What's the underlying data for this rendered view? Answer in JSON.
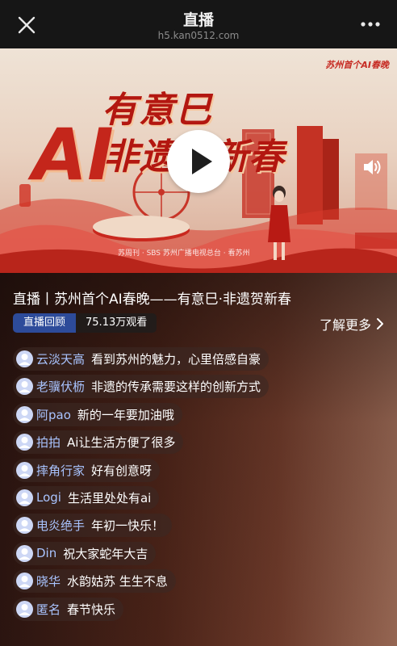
{
  "header": {
    "title": "直播",
    "url": "h5.kan0512.com"
  },
  "video": {
    "brand_tag": "苏州首个AI春晚",
    "poster_line1": "有意巳",
    "poster_ai": "AI",
    "poster_line2": "非遗贺新春",
    "credits": "苏周刊 · SBS 苏州广播电视总台 · 看苏州"
  },
  "stream": {
    "title": "直播丨苏州首个AI春晚——有意巳·非遗贺新春",
    "replay_label": "直播回顾",
    "views": "75.13万观看",
    "learn_more": "了解更多"
  },
  "comments": [
    {
      "user": "云淡天高",
      "text": "看到苏州的魅力，心里倍感自豪"
    },
    {
      "user": "老骥伏枥",
      "text": "非遗的传承需要这样的创新方式"
    },
    {
      "user": "阿pao",
      "text": "新的一年要加油哦"
    },
    {
      "user": "拍拍",
      "text": "Ai让生活方便了很多"
    },
    {
      "user": "摔角行家",
      "text": "好有创意呀"
    },
    {
      "user": "Logi",
      "text": "生活里处处有ai"
    },
    {
      "user": "电炎绝手",
      "text": "年初一快乐！"
    },
    {
      "user": "Din",
      "text": "祝大家蛇年大吉"
    },
    {
      "user": "晓华",
      "text": "水韵姑苏 生生不息"
    },
    {
      "user": "匿名",
      "text": "春节快乐"
    }
  ],
  "colors": {
    "replay_badge": "#2d4b9a",
    "username": "#a9c4ff",
    "poster_red": "#c4261b"
  },
  "icons": {
    "close": "close-icon",
    "more": "more-icon",
    "play": "play-icon",
    "volume": "volume-icon",
    "chevron": "chevron-right-icon",
    "avatar": "user-avatar-icon"
  }
}
